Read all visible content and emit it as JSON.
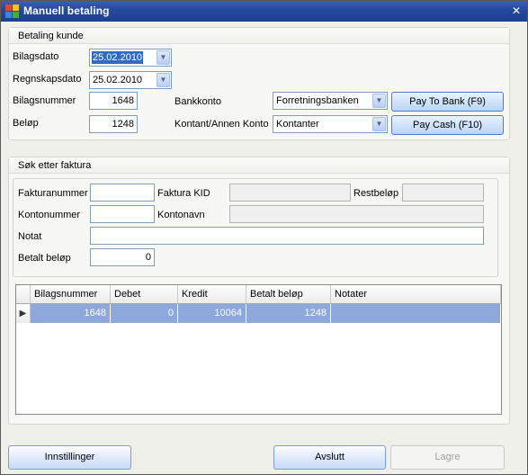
{
  "window": {
    "title": "Manuell betaling",
    "close_symbol": "✕"
  },
  "betaling": {
    "title": "Betaling kunde",
    "bilagsdato": {
      "label": "Bilagsdato",
      "value": "25.02.2010"
    },
    "regnskapsdato": {
      "label": "Regnskapsdato",
      "value": "25.02.2010"
    },
    "bilagsnummer": {
      "label": "Bilagsnummer",
      "value": "1648"
    },
    "belop": {
      "label": "Beløp",
      "value": "1248"
    },
    "bankkonto": {
      "label": "Bankkonto",
      "value": "Forretningsbanken"
    },
    "kontant": {
      "label": "Kontant/Annen Konto",
      "value": "Kontanter"
    },
    "pay_bank": "Pay To Bank (F9)",
    "pay_cash": "Pay Cash (F10)"
  },
  "sok": {
    "title": "Søk etter faktura",
    "fakturanummer": {
      "label": "Fakturanummer",
      "value": ""
    },
    "faktura_kid": {
      "label": "Faktura KID",
      "value": ""
    },
    "restbelop": {
      "label": "Restbeløp",
      "value": ""
    },
    "kontonummer": {
      "label": "Kontonummer",
      "value": ""
    },
    "kontonavn": {
      "label": "Kontonavn",
      "value": ""
    },
    "notat": {
      "label": "Notat",
      "value": ""
    },
    "betalt_belop": {
      "label": "Betalt beløp",
      "value": "0"
    }
  },
  "table": {
    "columns": [
      "Bilagsnummer",
      "Debet",
      "Kredit",
      "Betalt beløp",
      "Notater"
    ],
    "rows": [
      [
        "1648",
        "0",
        "10064",
        "1248",
        ""
      ]
    ],
    "row_marker": "▶"
  },
  "footer": {
    "innstillinger": "Innstillinger",
    "avslutt": "Avslutt",
    "lagre": "Lagre"
  },
  "icons": {
    "dropdown": "chevron-down-icon",
    "app": "app-window-icon",
    "close": "close-icon"
  },
  "colors": {
    "titlebar": "#244a9e",
    "selection": "#316ac5",
    "row_highlight": "#8fa8dc"
  }
}
